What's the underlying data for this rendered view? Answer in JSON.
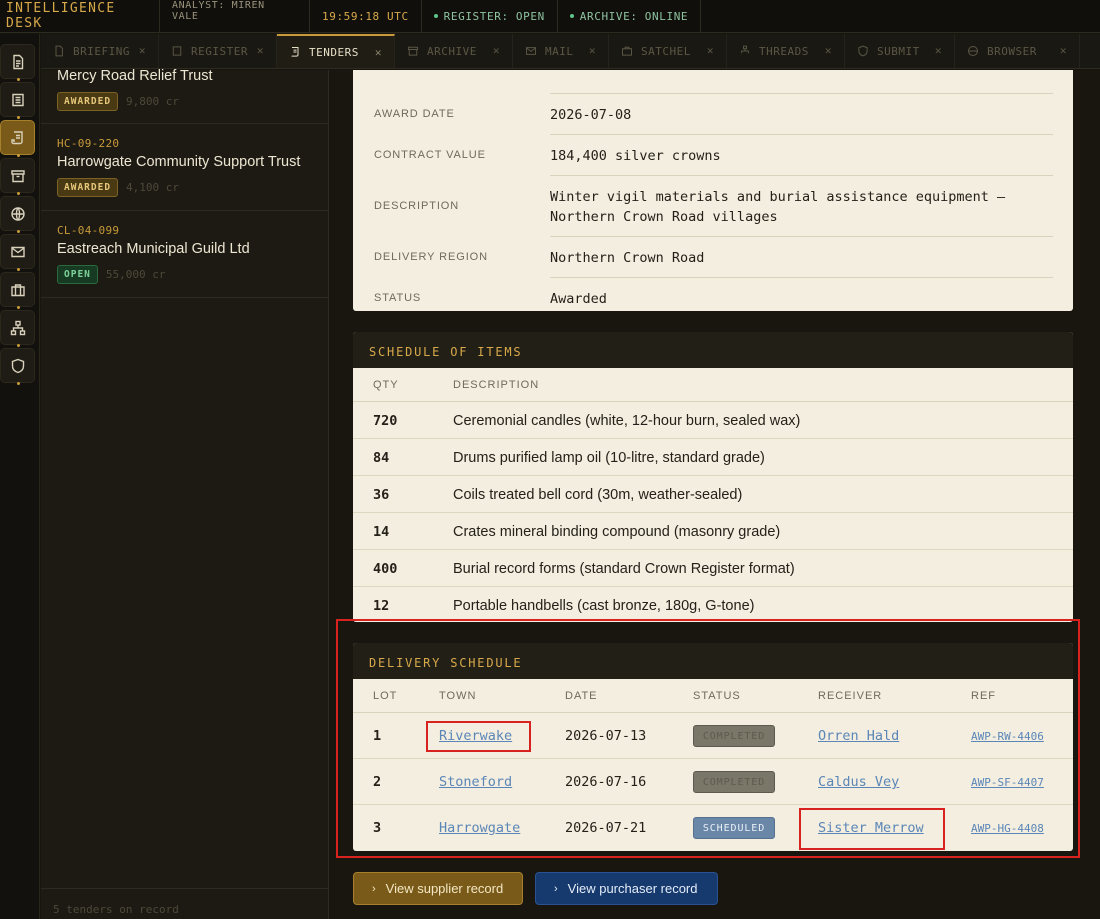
{
  "topbar": {
    "brand": "INTELLIGENCE DESK",
    "analyst": "ANALYST: MIREN VALE",
    "clock": "19:59:18 UTC",
    "register": "REGISTER: OPEN",
    "archive": "ARCHIVE: ONLINE"
  },
  "rail": {
    "items": [
      {
        "icon": "document-icon"
      },
      {
        "icon": "register-icon"
      },
      {
        "icon": "tenders-icon",
        "active": true
      },
      {
        "icon": "archive-box-icon"
      },
      {
        "icon": "globe-icon"
      },
      {
        "icon": "mail-icon"
      },
      {
        "icon": "satchel-icon"
      },
      {
        "icon": "threads-icon"
      },
      {
        "icon": "shield-icon"
      }
    ]
  },
  "tabs": [
    {
      "label": "BRIEFING",
      "icon": "document-icon"
    },
    {
      "label": "REGISTER",
      "icon": "register-icon"
    },
    {
      "label": "TENDERS",
      "icon": "tenders-icon",
      "active": true
    },
    {
      "label": "ARCHIVE",
      "icon": "archive-box-icon"
    },
    {
      "label": "MAIL",
      "icon": "mail-icon"
    },
    {
      "label": "SATCHEL",
      "icon": "satchel-icon"
    },
    {
      "label": "THREADS",
      "icon": "threads-icon"
    },
    {
      "label": "SUBMIT",
      "icon": "shield-icon"
    },
    {
      "label": "BROWSER",
      "icon": "globe-icon"
    }
  ],
  "tender_list": {
    "items": [
      {
        "code": "",
        "name": "Mercy Road Relief Trust",
        "status": "AWARDED",
        "amount": "9,800 cr"
      },
      {
        "code": "HC-09-220",
        "name": "Harrowgate Community Support Trust",
        "status": "AWARDED",
        "amount": "4,100 cr"
      },
      {
        "code": "CL-04-099",
        "name": "Eastreach Municipal Guild Ltd",
        "status": "OPEN",
        "amount": "55,000 cr"
      }
    ],
    "footer": "5 tenders on record"
  },
  "details": {
    "award_date_label": "AWARD DATE",
    "award_date": "2026-07-08",
    "contract_value_label": "CONTRACT VALUE",
    "contract_value": "184,400 silver crowns",
    "description_label": "DESCRIPTION",
    "description": "Winter vigil materials and burial assistance equipment — Northern Crown Road villages",
    "delivery_region_label": "DELIVERY REGION",
    "delivery_region": "Northern Crown Road",
    "status_label": "STATUS",
    "status": "Awarded"
  },
  "schedule": {
    "title": "SCHEDULE OF ITEMS",
    "columns": {
      "qty": "QTY",
      "description": "DESCRIPTION"
    },
    "rows": [
      {
        "qty": "720",
        "description": "Ceremonial candles (white, 12-hour burn, sealed wax)"
      },
      {
        "qty": "84",
        "description": "Drums purified lamp oil (10-litre, standard grade)"
      },
      {
        "qty": "36",
        "description": "Coils treated bell cord (30m, weather-sealed)"
      },
      {
        "qty": "14",
        "description": "Crates mineral binding compound (masonry grade)"
      },
      {
        "qty": "400",
        "description": "Burial record forms (standard Crown Register format)"
      },
      {
        "qty": "12",
        "description": "Portable handbells (cast bronze, 180g, G-tone)"
      }
    ]
  },
  "delivery": {
    "title": "DELIVERY SCHEDULE",
    "columns": {
      "lot": "LOT",
      "town": "TOWN",
      "date": "DATE",
      "status": "STATUS",
      "receiver": "RECEIVER",
      "ref": "REF"
    },
    "rows": [
      {
        "lot": "1",
        "town": "Riverwake",
        "date": "2026-07-13",
        "status": "COMPLETED",
        "receiver": "Orren Hald",
        "ref": "AWP-RW-4406"
      },
      {
        "lot": "2",
        "town": "Stoneford",
        "date": "2026-07-16",
        "status": "COMPLETED",
        "receiver": "Caldus Vey",
        "ref": "AWP-SF-4407"
      },
      {
        "lot": "3",
        "town": "Harrowgate",
        "date": "2026-07-21",
        "status": "SCHEDULED",
        "receiver": "Sister Merrow",
        "ref": "AWP-HG-4408"
      }
    ]
  },
  "actions": {
    "supplier": "View supplier record",
    "purchaser": "View purchaser record"
  },
  "colors": {
    "accent": "#c99a3a",
    "highlight": "#d8221f",
    "link": "#5b86b8"
  }
}
